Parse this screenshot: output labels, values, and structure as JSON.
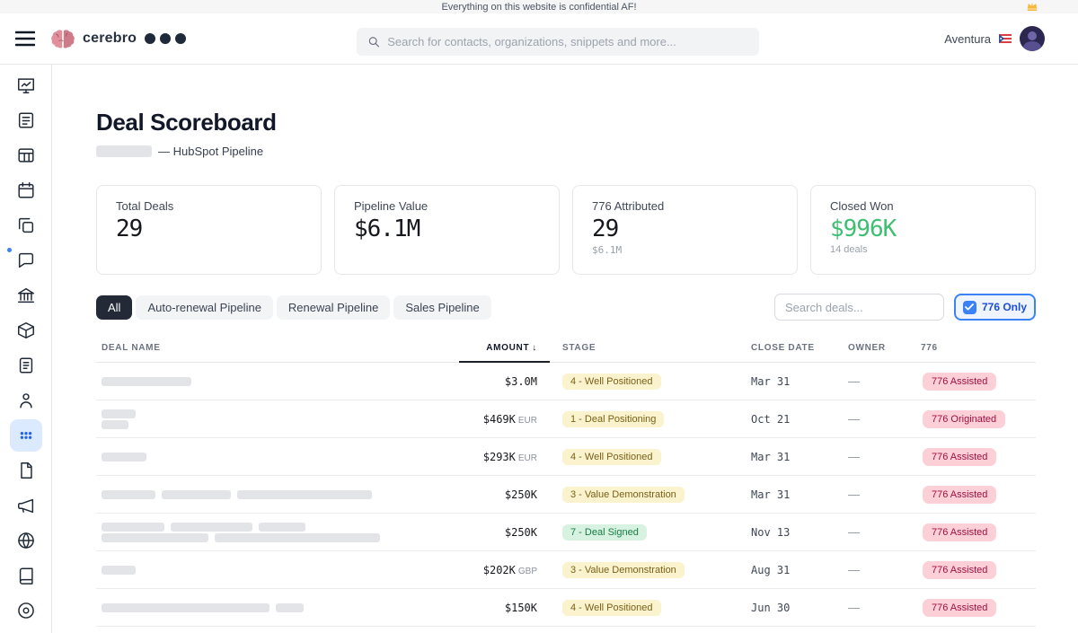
{
  "banner": {
    "text": "Everything on this website is confidential AF!"
  },
  "header": {
    "logo_text": "cerebro",
    "search_placeholder": "Search for contacts, organizations, snippets and more...",
    "org_name": "Aventura"
  },
  "sidebar": {
    "items": [
      "dashboard",
      "list",
      "table",
      "calendar",
      "copy",
      "chat",
      "bank",
      "package",
      "notes",
      "person",
      "apps",
      "file",
      "megaphone",
      "globe",
      "book",
      "disc"
    ],
    "active_item": "apps"
  },
  "page": {
    "title": "Deal Scoreboard",
    "subtitle": "— HubSpot Pipeline"
  },
  "stats": [
    {
      "label": "Total Deals",
      "value": "29",
      "sub": ""
    },
    {
      "label": "Pipeline Value",
      "value": "$6.1M",
      "sub": ""
    },
    {
      "label": "776 Attributed",
      "value": "29",
      "sub": "$6.1M"
    },
    {
      "label": "Closed Won",
      "value": "$996K",
      "sub": "14 deals"
    }
  ],
  "filters": {
    "tabs": [
      {
        "label": "All",
        "active": true
      },
      {
        "label": "Auto-renewal Pipeline",
        "active": false
      },
      {
        "label": "Renewal Pipeline",
        "active": false
      },
      {
        "label": "Sales Pipeline",
        "active": false
      }
    ],
    "search_placeholder": "Search deals...",
    "toggle_label": "776 Only",
    "toggle_checked": true
  },
  "table": {
    "columns": [
      "Deal Name",
      "Amount",
      "Stage",
      "Close Date",
      "Owner",
      "776"
    ],
    "sort_indicator": "↓",
    "sorted_column": "Amount",
    "rows": [
      {
        "name_skeleton": [
          [
            100
          ]
        ],
        "amount": "$3.0M",
        "currency": "",
        "stage": "4 - Well Positioned",
        "stage_tone": "yellow",
        "close_date": "Mar 31",
        "owner": "—",
        "badge": "776 Assisted"
      },
      {
        "name_skeleton": [
          [
            38
          ],
          [
            30
          ]
        ],
        "amount": "$469K",
        "currency": "EUR",
        "stage": "1 - Deal Positioning",
        "stage_tone": "yellow",
        "close_date": "Oct 21",
        "owner": "—",
        "badge": "776 Originated"
      },
      {
        "name_skeleton": [
          [
            50
          ]
        ],
        "amount": "$293K",
        "currency": "EUR",
        "stage": "4 - Well Positioned",
        "stage_tone": "yellow",
        "close_date": "Mar 31",
        "owner": "—",
        "badge": "776 Assisted"
      },
      {
        "name_skeleton": [
          [
            60,
            77,
            150
          ]
        ],
        "amount": "$250K",
        "currency": "",
        "stage": "3 - Value Demonstration",
        "stage_tone": "yellow",
        "close_date": "Mar 31",
        "owner": "—",
        "badge": "776 Assisted"
      },
      {
        "name_skeleton": [
          [
            70,
            91,
            52
          ],
          [
            119,
            184
          ]
        ],
        "amount": "$250K",
        "currency": "",
        "stage": "7 - Deal Signed",
        "stage_tone": "green",
        "close_date": "Nov 13",
        "owner": "—",
        "badge": "776 Assisted"
      },
      {
        "name_skeleton": [
          [
            38
          ]
        ],
        "amount": "$202K",
        "currency": "GBP",
        "stage": "3 - Value Demonstration",
        "stage_tone": "yellow",
        "close_date": "Aug 31",
        "owner": "—",
        "badge": "776 Assisted"
      },
      {
        "name_skeleton": [
          [
            187,
            31
          ]
        ],
        "amount": "$150K",
        "currency": "",
        "stage": "4 - Well Positioned",
        "stage_tone": "yellow",
        "close_date": "Jun 30",
        "owner": "—",
        "badge": "776 Assisted"
      }
    ]
  },
  "colors": {
    "accent_blue": "#3b82f6",
    "green_value": "#3fbf71",
    "badge_776_bg": "#fcd0d6",
    "badge_776_text": "#a11043",
    "stage_yellow_bg": "#faf3cd",
    "stage_green_bg": "#d7f2e0",
    "active_tab_bg": "#232936"
  }
}
